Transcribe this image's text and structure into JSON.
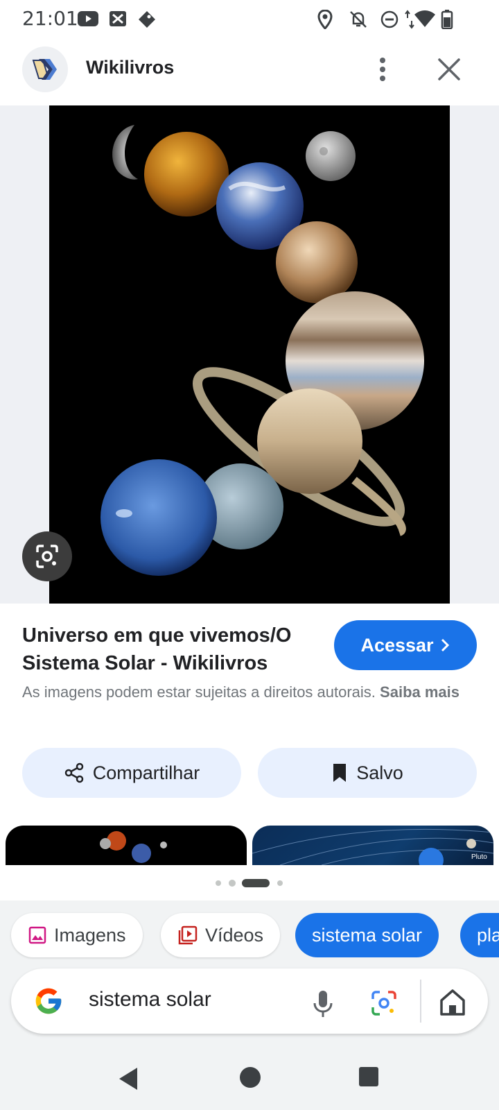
{
  "status_bar": {
    "time": "21:01",
    "icons": [
      "youtube-icon",
      "photos-icon",
      "tag-icon",
      "location-icon",
      "bell-off-icon",
      "do-not-disturb-icon",
      "data-arrows-icon",
      "wifi-icon",
      "battery-icon"
    ]
  },
  "header": {
    "site_name": "Wikilivros",
    "icons": [
      "wikibooks-logo",
      "more-vert-icon",
      "close-icon"
    ]
  },
  "result": {
    "title": "Universo em que vivemos/O Sistema Solar - Wikilivros",
    "visit_label": "Acessar",
    "copyright_text": "As imagens podem estar sujeitas a direitos autorais.",
    "learn_more": "Saiba mais",
    "share_label": "Compartilhar",
    "saved_label": "Salvo",
    "thumb2_label": "Pluto"
  },
  "pagination": {
    "total": 4,
    "active_index": 2
  },
  "chips": [
    {
      "label": "Imagens",
      "icon": "image-icon"
    },
    {
      "label": "Vídeos",
      "icon": "video-icon"
    },
    {
      "label": "sistema solar",
      "active": true
    },
    {
      "label": "pla"
    }
  ],
  "search": {
    "query": "sistema solar",
    "icons": [
      "google-logo",
      "mic-icon",
      "lens-icon",
      "home-icon"
    ]
  },
  "colors": {
    "accent": "#1a73e8",
    "chip_bg": "#e8f0fe",
    "panel_bg": "#f1f3f4"
  }
}
